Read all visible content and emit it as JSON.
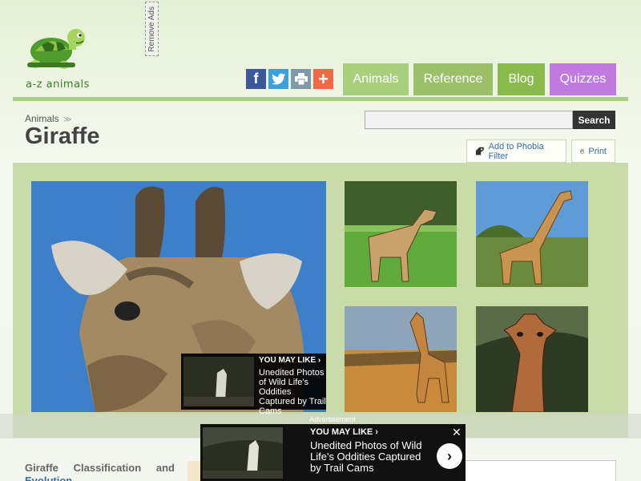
{
  "brand": {
    "logo_text": "a-z animals"
  },
  "ads": {
    "remove_ads_label": "Remove Ads",
    "advertisement_label": "Advertisement"
  },
  "social": {
    "facebook": "f",
    "twitter": "twitter-icon",
    "print": "print-icon",
    "plus": "+"
  },
  "nav": {
    "items": [
      {
        "label": "Animals",
        "color": "#a9cf7d"
      },
      {
        "label": "Reference",
        "color": "#9cc06a"
      },
      {
        "label": "Blog",
        "color": "#88bb4c"
      },
      {
        "label": "Quizzes",
        "color": "#c17be0"
      }
    ]
  },
  "breadcrumb": {
    "animals": "Animals",
    "separator": "≫"
  },
  "page": {
    "title": "Giraffe"
  },
  "search": {
    "placeholder": "",
    "button_label": "Search"
  },
  "toolbar": {
    "phobia_filter_label": "Add to Phobia Filter",
    "print_label": "Print"
  },
  "you_may_like_small": {
    "heading": "YOU MAY LIKE ›",
    "text": "Unedited Photos of Wild Life's Oddities Captured by Trail Cams"
  },
  "you_may_like_big": {
    "heading": "YOU MAY LIKE ›",
    "text": "Unedited Photos of Wild Life's Oddities Captured by Trail Cams",
    "close": "✕",
    "next": "›"
  },
  "content": {
    "section_heading_words": [
      "Giraffe",
      "Classification",
      "and"
    ],
    "section_heading_line2": "Evolution"
  },
  "colors": {
    "accent_green": "#a9cf7d",
    "quiz_purple": "#c17be0",
    "gallery_bg": "#c8dba8"
  }
}
